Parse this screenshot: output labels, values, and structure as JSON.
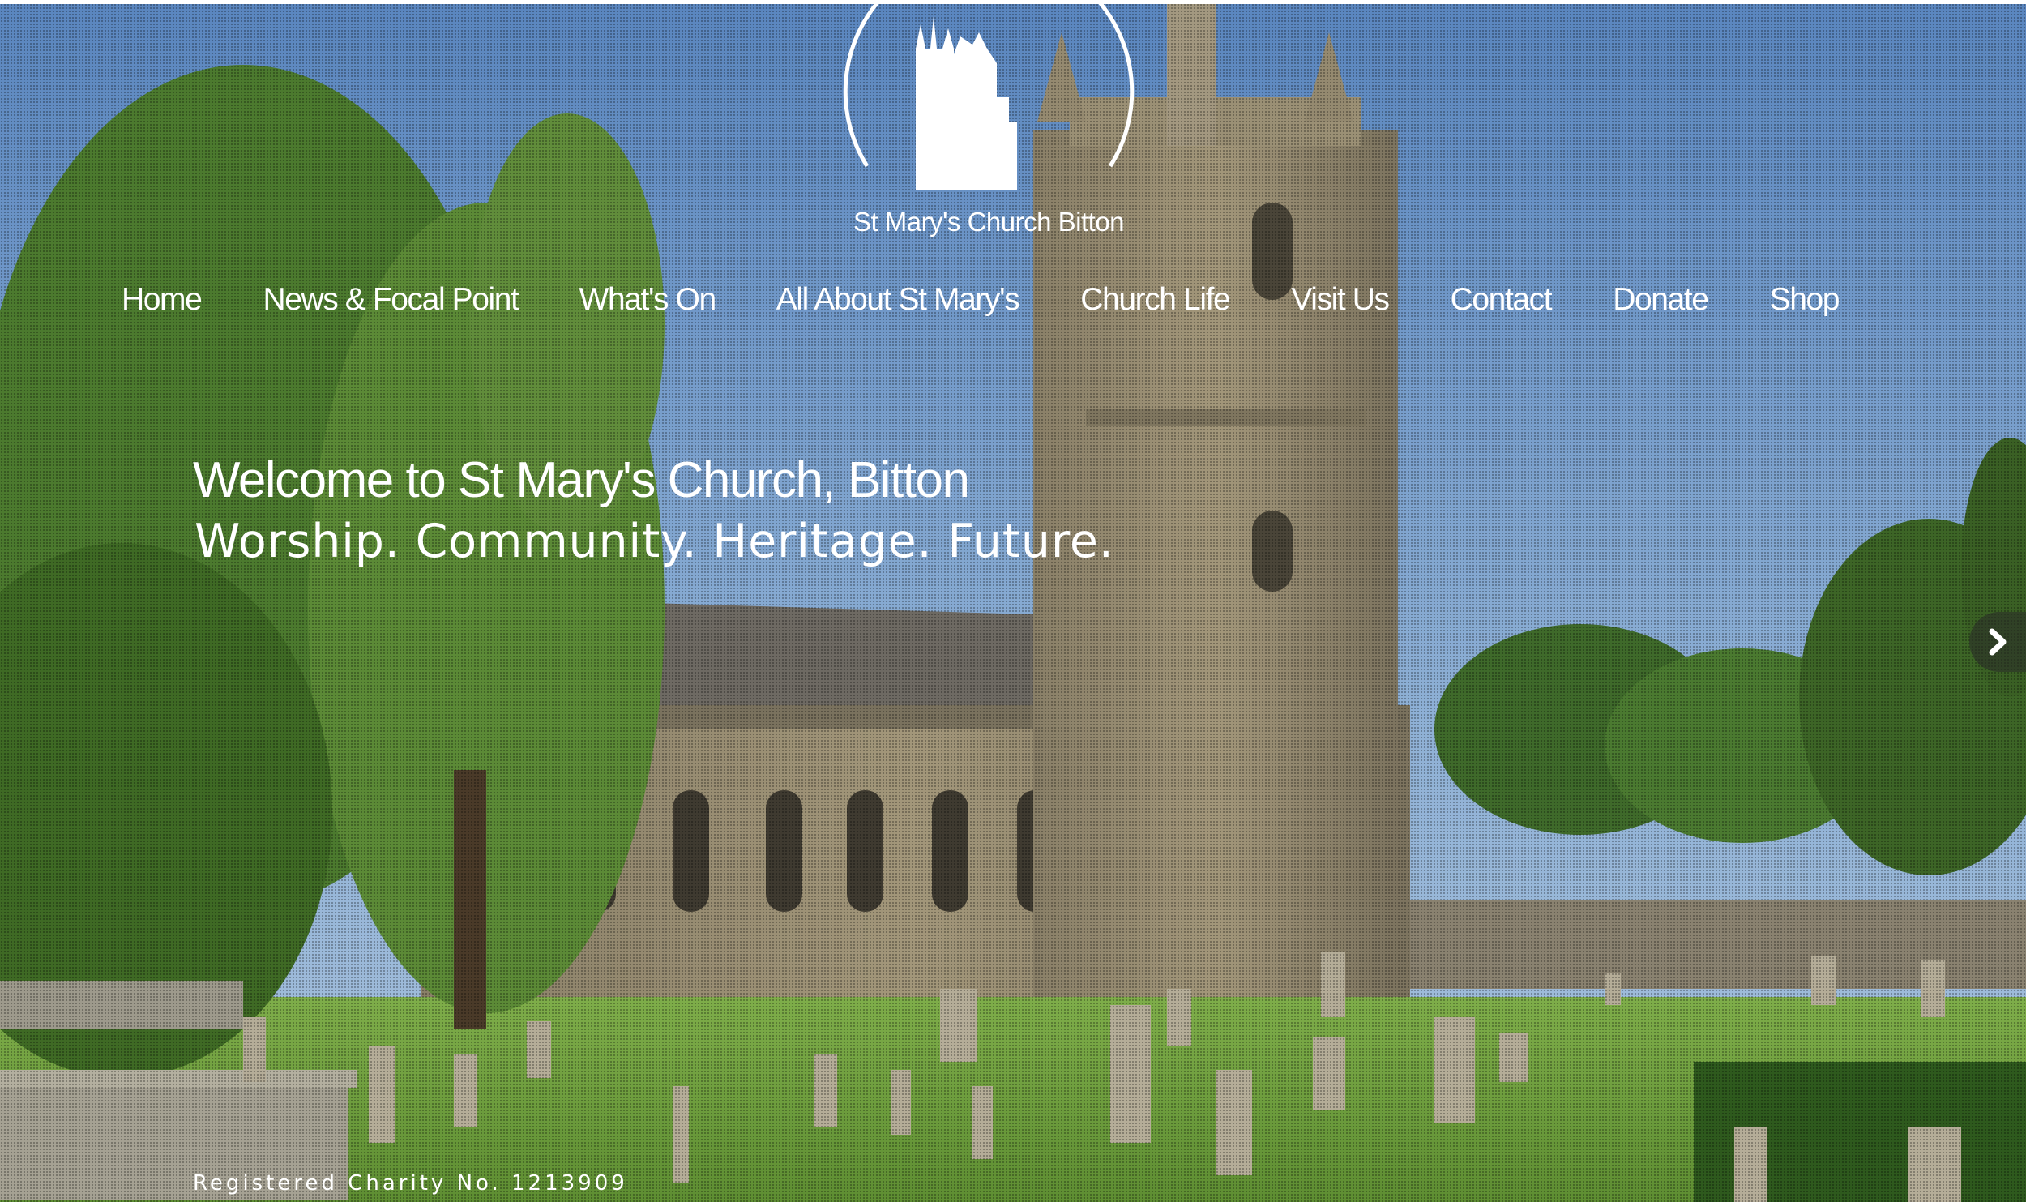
{
  "site": {
    "logo_text": "St Mary's Church Bitton"
  },
  "nav": {
    "items": [
      {
        "label": "Home"
      },
      {
        "label": "News & Focal Point"
      },
      {
        "label": "What's On"
      },
      {
        "label": "All About St Mary's"
      },
      {
        "label": "Church Life"
      },
      {
        "label": "Visit Us"
      },
      {
        "label": "Contact"
      },
      {
        "label": "Donate"
      },
      {
        "label": "Shop"
      }
    ]
  },
  "hero": {
    "title": "Welcome to St Mary's Church, Bitton",
    "subtitle": "Worship. Community. Heritage. Future.",
    "footer_text": "Registered Charity No. 1213909",
    "next_icon": "chevron-right-icon"
  }
}
